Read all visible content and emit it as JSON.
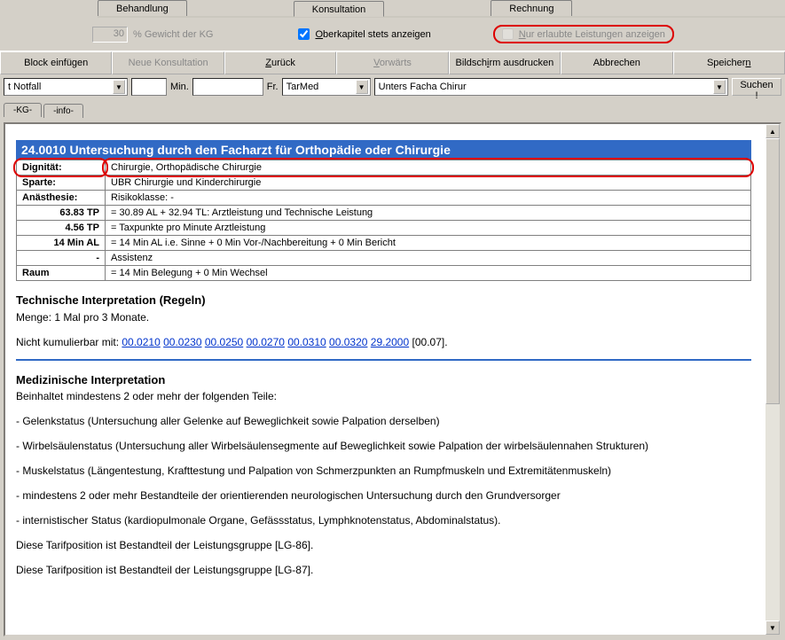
{
  "top_tabs": {
    "behandlung": "Behandlung",
    "konsultation": "Konsultation",
    "rechnung": "Rechnung"
  },
  "options": {
    "num": "30",
    "num_label": "% Gewicht der KG",
    "ober_cb_accel": "O",
    "ober_cb_text": "berkapitel stets anzeigen",
    "nur_cb_accel": "N",
    "nur_cb_text": "ur erlaubte Leistungen anzeigen"
  },
  "buttons": {
    "block": "Block einfügen",
    "neue": "Neue Konsultation",
    "zuruck_text": "urück",
    "zuruck_accel": "Z",
    "vor_text": "orwärts",
    "vor_accel": "V",
    "bild_pre": "Bildsch",
    "bild_accel": "i",
    "bild_post": "rm ausdrucken",
    "abbrechen": "Abbrechen",
    "speichern_pre": "Speicher",
    "speichern_accel": "n"
  },
  "filter": {
    "drop1": "t Notfall",
    "min": "Min.",
    "fr": "Fr.",
    "tarmed": "TarMed",
    "search_value": "Unters Facha Chirur",
    "suchen": "Suchen !"
  },
  "subtabs": {
    "kg": "-KG-",
    "info": "-info-"
  },
  "header_title": "24.0010 Untersuchung durch den Facharzt für Orthopädie oder Chirurgie",
  "rows": {
    "dign_k": "Dignität:",
    "dign_v": "Chirurgie, Orthopädische Chirurgie",
    "sparte_k": "Sparte:",
    "sparte_v": "UBR Chirurgie und Kinderchirurgie",
    "anas_k": "Anästhesie:",
    "anas_v": "Risikoklasse: -",
    "tp1_k": "63.83 TP",
    "tp1_v": "= 30.89 AL + 32.94 TL: Arztleistung und Technische Leistung",
    "tp2_k": "4.56 TP",
    "tp2_v": "= Taxpunkte pro Minute Arztleistung",
    "al_k": "14 Min AL",
    "al_v": "= 14 Min AL i.e. Sinne + 0 Min Vor-/Nachbereitung + 0 Min Bericht",
    "as_k": "-",
    "as_v": "Assistenz",
    "raum_k": "Raum",
    "raum_v": "= 14 Min Belegung + 0 Min Wechsel"
  },
  "tech": {
    "title": "Technische Interpretation (Regeln)",
    "menge": "Menge: 1 Mal pro 3 Monate.",
    "kumul_pre": "Nicht kumulierbar mit: ",
    "links": [
      "00.0210",
      "00.0230",
      "00.0250",
      "00.0270",
      "00.0310",
      "00.0320",
      "29.2000"
    ],
    "kumul_post": " [00.07]."
  },
  "med": {
    "title": "Medizinische Interpretation",
    "intro": "Beinhaltet mindestens 2 oder mehr der folgenden Teile:",
    "li1": "- Gelenkstatus (Untersuchung aller Gelenke auf Beweglichkeit sowie Palpation derselben)",
    "li2": "- Wirbelsäulenstatus (Untersuchung aller Wirbelsäulensegmente auf Beweglichkeit sowie Palpation der wirbelsäulennahen Strukturen)",
    "li3": "- Muskelstatus (Längentestung, Krafttestung und Palpation von Schmerzpunkten an Rumpfmuskeln und Extremitätenmuskeln)",
    "li4": "- mindestens 2 oder mehr Bestandteile der orientierenden neurologischen Untersuchung durch den Grundversorger",
    "li5": "- internistischer Status (kardiopulmonale Organe, Gefässstatus, Lymphknotenstatus, Abdominalstatus).",
    "lg1": "Diese Tarifposition ist Bestandteil der Leistungsgruppe [LG-86].",
    "lg2": "Diese Tarifposition ist Bestandteil der Leistungsgruppe [LG-87]."
  }
}
